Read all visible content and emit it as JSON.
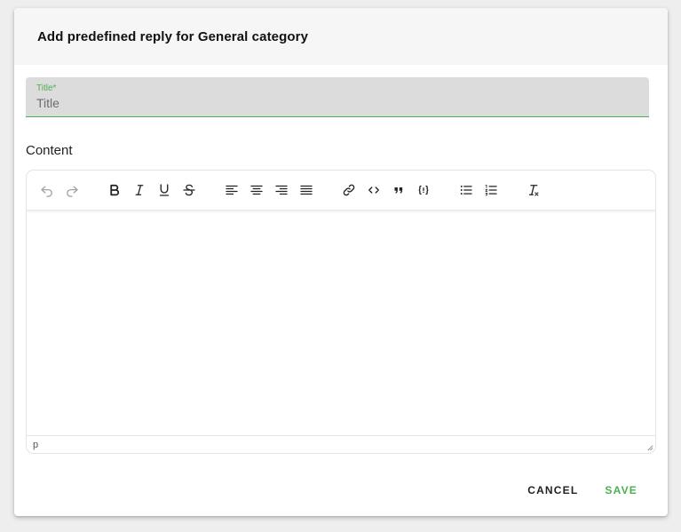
{
  "dialog": {
    "title": "Add predefined reply for General category",
    "title_field": {
      "label": "Title*",
      "placeholder": "Title",
      "value": ""
    },
    "content_label": "Content",
    "editor": {
      "toolbar": [
        {
          "icon": "undo-icon",
          "name": "undo-button",
          "enabled": false
        },
        {
          "icon": "redo-icon",
          "name": "redo-button",
          "enabled": false
        },
        {
          "icon": "bold-icon",
          "name": "bold-button",
          "enabled": true
        },
        {
          "icon": "italic-icon",
          "name": "italic-button",
          "enabled": true
        },
        {
          "icon": "underline-icon",
          "name": "underline-button",
          "enabled": true
        },
        {
          "icon": "strikethrough-icon",
          "name": "strikethrough-button",
          "enabled": true
        },
        {
          "icon": "align-left-icon",
          "name": "align-left-button",
          "enabled": true
        },
        {
          "icon": "align-center-icon",
          "name": "align-center-button",
          "enabled": true
        },
        {
          "icon": "align-right-icon",
          "name": "align-right-button",
          "enabled": true
        },
        {
          "icon": "align-justify-icon",
          "name": "align-justify-button",
          "enabled": true
        },
        {
          "icon": "link-icon",
          "name": "link-button",
          "enabled": true
        },
        {
          "icon": "code-icon",
          "name": "code-button",
          "enabled": true
        },
        {
          "icon": "blockquote-icon",
          "name": "blockquote-button",
          "enabled": true
        },
        {
          "icon": "code-sample-icon",
          "name": "code-sample-button",
          "enabled": true
        },
        {
          "icon": "bullet-list-icon",
          "name": "bullet-list-button",
          "enabled": true
        },
        {
          "icon": "numbered-list-icon",
          "name": "numbered-list-button",
          "enabled": true
        },
        {
          "icon": "clear-formatting-icon",
          "name": "clear-formatting-button",
          "enabled": true
        }
      ],
      "status_path": "p"
    },
    "actions": {
      "cancel_label": "CANCEL",
      "save_label": "SAVE"
    }
  },
  "colors": {
    "accent": "#4caf50",
    "header_bg": "#f6f6f6",
    "field_bg": "#dcdcdc"
  }
}
